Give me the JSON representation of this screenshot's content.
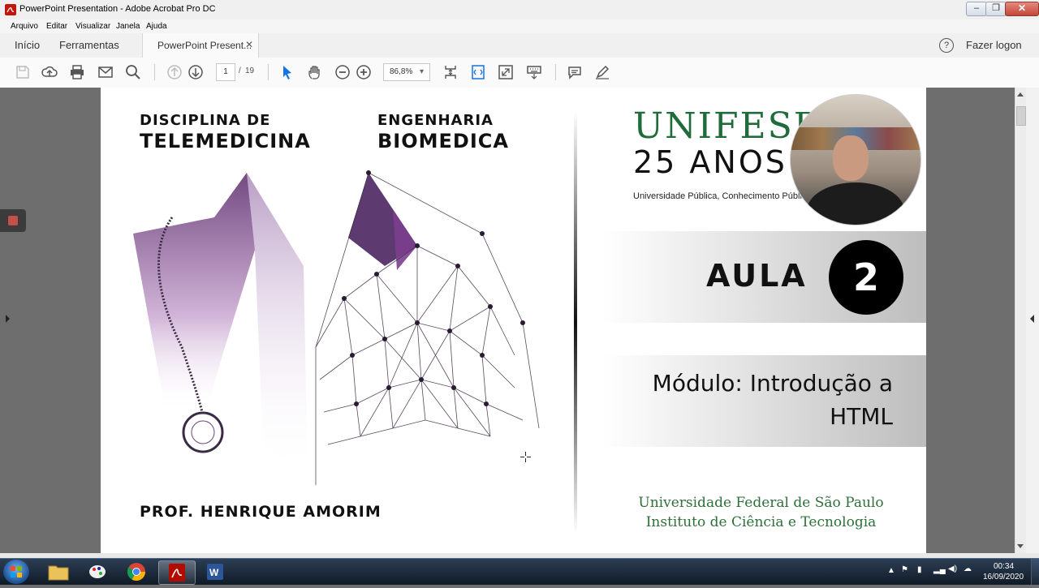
{
  "window": {
    "title": "PowerPoint Presentation - Adobe Acrobat Pro DC",
    "minimize": "–",
    "maximize": "❐",
    "close": "✕"
  },
  "menu": [
    "Arquivo",
    "Editar",
    "Visualizar",
    "Janela",
    "Ajuda"
  ],
  "tabs": {
    "home": "Início",
    "tools": "Ferramentas",
    "document": "PowerPoint Present...",
    "document_close": "✕",
    "help": "?",
    "login": "Fazer logon"
  },
  "toolbar": {
    "page_current": "1",
    "page_sep": "/",
    "page_total": "19",
    "zoom": "86,8%",
    "zoom_caret": "▾"
  },
  "slide": {
    "left_top_small": "DISCIPLINA DE",
    "left_top_big": "TELEMEDICINA",
    "right_top_small": "ENGENHARIA",
    "right_top_big": "BIOMEDICA",
    "professor": "PROF. HENRIQUE AMORIM",
    "logo_name": "UNIFESP",
    "logo_years": "25 ANOS",
    "logo_tagline": "Universidade Pública, Conhecimento Público",
    "aula_label": "AULA",
    "aula_number": "2",
    "module_line1": "Módulo: Introdução a",
    "module_line2": "HTML",
    "university": "Universidade Federal de São Paulo",
    "institute": "Instituto de Ciência e Tecnologia"
  },
  "clock": {
    "time": "00:34",
    "date": "16/09/2020"
  },
  "colors": {
    "accent_purple": "#5a2a6b",
    "unifesp_green": "#1f6b3a",
    "acrobat_red": "#b30b00",
    "taskbar": "#1a2636"
  }
}
